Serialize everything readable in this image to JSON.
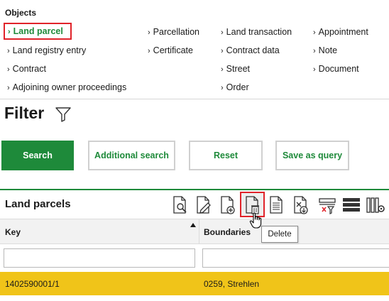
{
  "objects": {
    "title": "Objects",
    "links": [
      {
        "label": "Land parcel",
        "active": true
      },
      {
        "label": "Parcellation"
      },
      {
        "label": "Land transaction"
      },
      {
        "label": "Appointment"
      },
      {
        "label": "Land registry entry"
      },
      {
        "label": "Certificate"
      },
      {
        "label": "Contract data"
      },
      {
        "label": "Note"
      },
      {
        "label": "Contract"
      },
      {
        "label": "Street"
      },
      {
        "label": "Document"
      },
      {
        "label": "Adjoining owner proceedings"
      },
      {
        "label": "Order"
      }
    ]
  },
  "filter": {
    "title": "Filter",
    "icon": "funnel-icon",
    "buttons": {
      "search": "Search",
      "additional_search": "Additional search",
      "reset": "Reset",
      "save_query": "Save as query"
    }
  },
  "grid": {
    "title": "Land parcels",
    "toolbar": [
      "document-search-icon",
      "document-edit-icon",
      "document-add-icon",
      "document-delete-icon",
      "document-list-icon",
      "document-export-icon",
      "clear-filter-icon",
      "rows-view-icon",
      "column-settings-icon"
    ],
    "columns": [
      "Key",
      "Boundaries"
    ],
    "filters": [
      "",
      ""
    ],
    "rows": [
      {
        "key": "1402590001/1",
        "boundaries": "0259, Strehlen"
      }
    ]
  },
  "tooltip": "Delete",
  "colors": {
    "accent": "#1e8a3a",
    "highlight_border": "#e0232a",
    "selected_row": "#f0c419"
  }
}
